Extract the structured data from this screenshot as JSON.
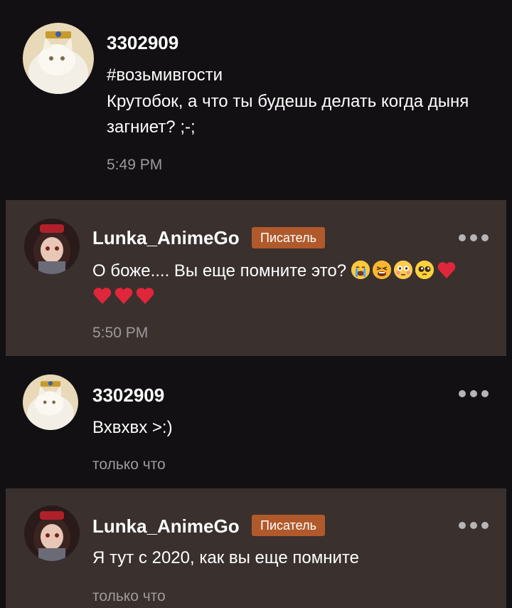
{
  "messages": [
    {
      "author": "3302909",
      "hashtag": "#возьмивгости",
      "text": "Крутобок, а что ты будешь делать когда дыня загниет? ;-;",
      "time": "5:49 PM"
    },
    {
      "author": "Lunka_AnimeGo",
      "badge": "Писатель",
      "text": "О боже.... Вы еще помните это?",
      "emojis": [
        "crying-face-emoji",
        "tired-face-emoji",
        "flushed-face-emoji",
        "pleading-face-emoji",
        "red-heart-emoji",
        "red-heart-emoji",
        "red-heart-emoji",
        "red-heart-emoji"
      ],
      "time": "5:50 PM"
    },
    {
      "author": "3302909",
      "text": "Вхвхвх >:)",
      "time": "только что"
    },
    {
      "author": "Lunka_AnimeGo",
      "badge": "Писатель",
      "text": "Я тут с 2020, как вы еще помните",
      "time": "только что"
    }
  ],
  "colors": {
    "background": "#121012",
    "highlight": "#3a302e",
    "badge": "#b05a2c",
    "heart": "#e0263a"
  }
}
